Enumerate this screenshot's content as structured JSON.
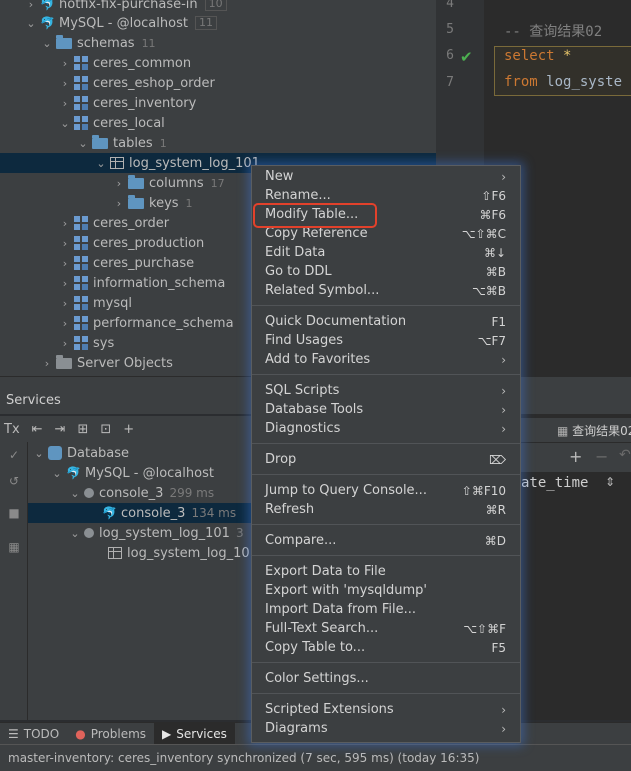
{
  "tree": {
    "rows": [
      {
        "label": "hotfix-fix-purchase-in",
        "count": "10",
        "count_box": true
      },
      {
        "label": "MySQL - @localhost",
        "count": "11",
        "count_box": true
      },
      {
        "label": "schemas",
        "count": "11"
      },
      {
        "label": "ceres_common"
      },
      {
        "label": "ceres_eshop_order"
      },
      {
        "label": "ceres_inventory"
      },
      {
        "label": "ceres_local"
      },
      {
        "label": "tables",
        "count": "1"
      },
      {
        "label": "log_system_log_101"
      },
      {
        "label": "columns",
        "count": "17"
      },
      {
        "label": "keys",
        "count": "1"
      },
      {
        "label": "ceres_order"
      },
      {
        "label": "ceres_production"
      },
      {
        "label": "ceres_purchase"
      },
      {
        "label": "information_schema"
      },
      {
        "label": "mysql"
      },
      {
        "label": "performance_schema"
      },
      {
        "label": "sys"
      },
      {
        "label": "Server Objects"
      }
    ]
  },
  "editor": {
    "line_numbers": [
      "4",
      "5",
      "6",
      "7"
    ],
    "comment": "-- 查询结果02",
    "kw_select": "select",
    "star": "*",
    "kw_from": "from",
    "table": "log_syste"
  },
  "services": {
    "title": "Services",
    "toolbar": [
      "Tx",
      "⇤",
      "⇥",
      "⊞",
      "⊡",
      "+"
    ],
    "tree": [
      {
        "label": "Database"
      },
      {
        "label": "MySQL - @localhost"
      },
      {
        "label": "console_3",
        "ms": "299 ms"
      },
      {
        "label": "console_3",
        "ms": "134 ms"
      },
      {
        "label": "log_system_log_101",
        "ms": "3"
      },
      {
        "label": "log_system_log_101"
      }
    ],
    "result_tab": "查询结果02",
    "column_header": "ate_time"
  },
  "context_menu": {
    "items": [
      {
        "label": "New",
        "submenu": true
      },
      {
        "label": "Rename...",
        "shortcut": "⇧F6"
      },
      {
        "label": "Modify Table...",
        "shortcut": "⌘F6"
      },
      {
        "label": "Copy Reference",
        "shortcut": "⌥⇧⌘C"
      },
      {
        "label": "Edit Data",
        "shortcut": "⌘↓"
      },
      {
        "label": "Go to DDL",
        "shortcut": "⌘B"
      },
      {
        "label": "Related Symbol...",
        "shortcut": "⌥⌘B"
      },
      {
        "label": "Quick Documentation",
        "shortcut": "F1"
      },
      {
        "label": "Find Usages",
        "shortcut": "⌥F7"
      },
      {
        "label": "Add to Favorites",
        "submenu": true
      },
      {
        "label": "SQL Scripts",
        "submenu": true
      },
      {
        "label": "Database Tools",
        "submenu": true
      },
      {
        "label": "Diagnostics",
        "submenu": true
      },
      {
        "label": "Drop",
        "shortcut": "⌦"
      },
      {
        "label": "Jump to Query Console...",
        "shortcut": "⇧⌘F10"
      },
      {
        "label": "Refresh",
        "shortcut": "⌘R"
      },
      {
        "label": "Compare...",
        "shortcut": "⌘D"
      },
      {
        "label": "Export Data to File"
      },
      {
        "label": "Export with 'mysqldump'"
      },
      {
        "label": "Import Data from File..."
      },
      {
        "label": "Full-Text Search...",
        "shortcut": "⌥⇧⌘F"
      },
      {
        "label": "Copy Table to...",
        "shortcut": "F5"
      },
      {
        "label": "Color Settings..."
      },
      {
        "label": "Scripted Extensions",
        "submenu": true
      },
      {
        "label": "Diagrams",
        "submenu": true
      }
    ]
  },
  "tool_tabs": [
    "TODO",
    "Problems",
    "Services"
  ],
  "status": "master-inventory: ceres_inventory synchronized (7 sec, 595 ms) (today 16:35)",
  "colors": {
    "accent_selection": "#0d293e",
    "highlight_box": "#e2412b",
    "menu_glow": "#3c78dc"
  }
}
